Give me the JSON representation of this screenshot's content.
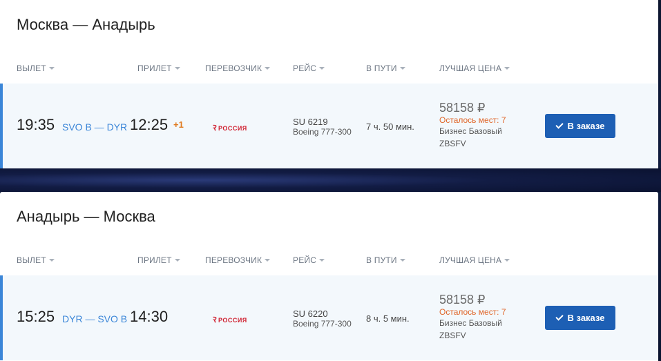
{
  "columns": [
    "ВЫЛЕТ",
    "ПРИЛЕТ",
    "ПЕРЕВОЗЧИК",
    "РЕЙС",
    "В ПУТИ",
    "ЛУЧШАЯ ЦЕНА"
  ],
  "outbound": {
    "title": "Москва — Анадырь",
    "dep_time": "19:35",
    "route": "SVO B — DYR",
    "arr_time": "12:25",
    "plus_day": "+1",
    "carrier": "РОССИЯ",
    "flight": "SU 6219",
    "aircraft": "Boeing 777-300",
    "duration": "7 ч. 50 мин.",
    "price": "58158 ₽",
    "seats": "Осталось мест: 7",
    "fare": "Бизнес Базовый",
    "fare_code": "ZBSFV",
    "button": "В заказе"
  },
  "inbound": {
    "title": "Анадырь — Москва",
    "dep_time": "15:25",
    "route": "DYR — SVO B",
    "arr_time": "14:30",
    "carrier": "РОССИЯ",
    "flight": "SU 6220",
    "aircraft": "Boeing 777-300",
    "duration": "8 ч. 5 мин.",
    "price": "58158 ₽",
    "seats": "Осталось мест: 7",
    "fare": "Бизнес Базовый",
    "fare_code": "ZBSFV",
    "button": "В заказе"
  },
  "colors": {
    "accent": "#3b86d8",
    "button": "#1d5fb4",
    "warning": "#e0662a",
    "carrier": "#d02030"
  }
}
